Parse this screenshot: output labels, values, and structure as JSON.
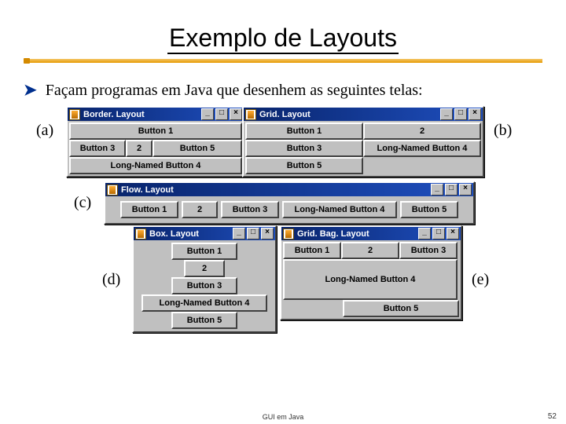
{
  "title": "Exemplo de Layouts",
  "intro_arrow": "➤",
  "intro": "Façam programas em Java que desenhem as seguintes telas:",
  "labels": {
    "a": "(a)",
    "b": "(b)",
    "c": "(c)",
    "d": "(d)",
    "e": "(e)"
  },
  "winctrl": {
    "min": "_",
    "max": "□",
    "close": "×"
  },
  "windows": {
    "a": {
      "title": "Border. Layout",
      "north": "Button 1",
      "west": "Button 3",
      "center": "2",
      "east": "Button 5",
      "south": "Long-Named Button 4"
    },
    "b": {
      "title": "Grid. Layout",
      "cells": {
        "r1c1": "Button 1",
        "r1c2": "2",
        "r2c1": "Button 3",
        "r2c2": "Long-Named Button 4",
        "r3c1": "Button 5"
      }
    },
    "c": {
      "title": "Flow. Layout",
      "items": {
        "b1": "Button 1",
        "b2": "2",
        "b3": "Button 3",
        "b4": "Long-Named Button 4",
        "b5": "Button 5"
      }
    },
    "d": {
      "title": "Box. Layout",
      "items": {
        "b1": "Button 1",
        "b2": "2",
        "b3": "Button 3",
        "b4": "Long-Named Button 4",
        "b5": "Button 5"
      }
    },
    "e": {
      "title": "Grid. Bag. Layout",
      "items": {
        "b1": "Button 1",
        "b2": "2",
        "b3": "Button 3",
        "b4": "Long-Named Button 4",
        "b5": "Button 5"
      }
    }
  },
  "footer": {
    "mid": "GUI em Java",
    "page": "52"
  }
}
